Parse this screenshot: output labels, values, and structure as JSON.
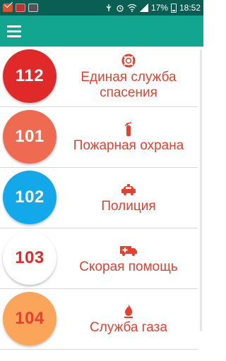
{
  "status_bar": {
    "signal_text": "17%",
    "time": "18:52",
    "icons": [
      "mail-icon",
      "photo-icon",
      "image-icon",
      "usb-icon",
      "alarm-icon",
      "wifi-icon",
      "signal-icon",
      "battery-icon"
    ]
  },
  "app_bar": {
    "menu_icon": "hamburger-menu-icon",
    "background": "#12a691"
  },
  "services": [
    {
      "number": "112",
      "label": "Единая служба спасения",
      "icon": "lifebuoy-icon",
      "badge_bg": "#e02a2a",
      "badge_fg": "#ffffff"
    },
    {
      "number": "101",
      "label": "Пожарная охрана",
      "icon": "fire-extinguisher-icon",
      "badge_bg": "#ee6a50",
      "badge_fg": "#ffffff"
    },
    {
      "number": "102",
      "label": "Полиция",
      "icon": "police-car-icon",
      "badge_bg": "#12a8ea",
      "badge_fg": "#ffffff"
    },
    {
      "number": "103",
      "label": "Скорая помощь",
      "icon": "ambulance-icon",
      "badge_bg": "#ffffff",
      "badge_fg": "#e02a2a"
    },
    {
      "number": "104",
      "label": "Служба газа",
      "icon": "gas-flame-icon",
      "badge_bg": "#fba55a",
      "badge_fg": "#e8402e"
    }
  ]
}
